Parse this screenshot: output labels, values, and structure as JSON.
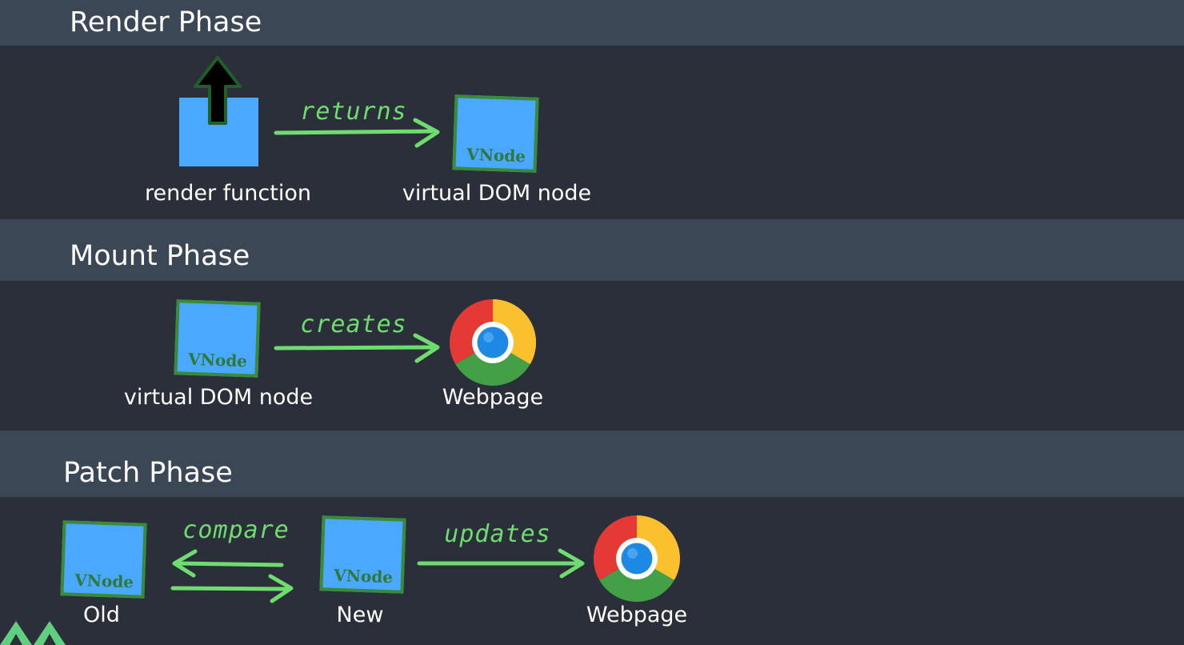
{
  "phases": {
    "render": {
      "title": "Render Phase",
      "source_caption": "render function",
      "verb": "returns",
      "target_caption": "virtual DOM node",
      "vnode_label": "VNode"
    },
    "mount": {
      "title": "Mount Phase",
      "source_caption": "virtual DOM node",
      "source_vnode_label": "VNode",
      "verb": "creates",
      "target_caption": "Webpage"
    },
    "patch": {
      "title": "Patch Phase",
      "old_caption": "Old",
      "old_vnode_label": "VNode",
      "compare_verb": "compare",
      "new_caption": "New",
      "new_vnode_label": "VNode",
      "update_verb": "updates",
      "target_caption": "Webpage"
    }
  },
  "icons": {
    "up_arrow": "up-arrow-icon",
    "chrome": "chrome-icon",
    "logo": "mountain-logo-icon"
  },
  "colors": {
    "header_bg": "#3c4756",
    "band_bg": "#2b2f39",
    "box_blue": "#4aa8ff",
    "hand_green": "#6fdc6f"
  }
}
